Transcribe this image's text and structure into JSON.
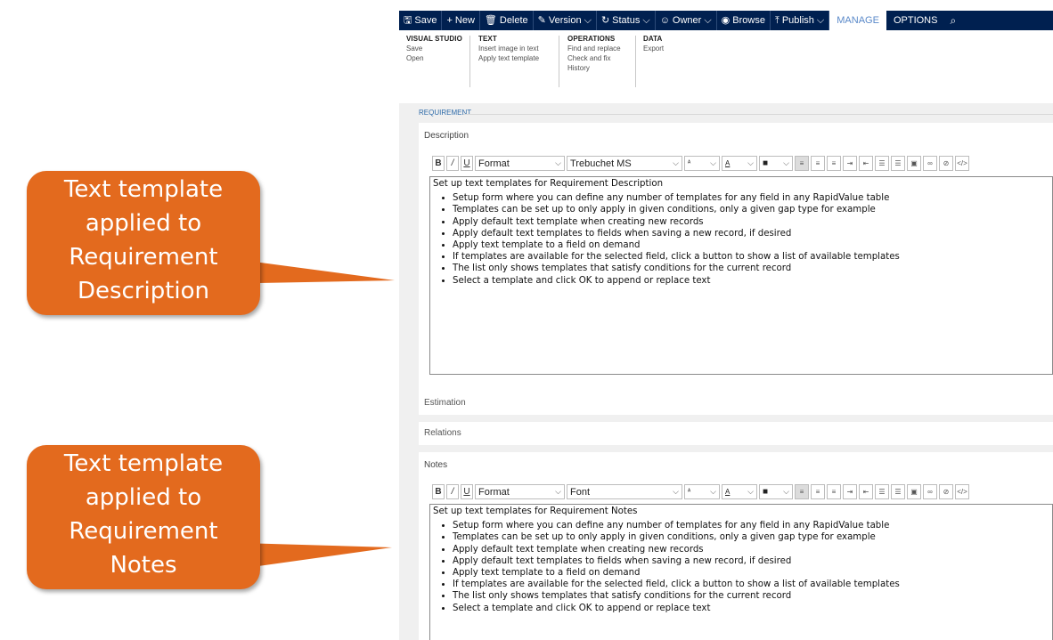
{
  "callouts": [
    {
      "lines": [
        "Text template",
        "applied to",
        "Requirement",
        "Description"
      ]
    },
    {
      "lines": [
        "Text template",
        "applied to",
        "Requirement",
        "Notes"
      ]
    }
  ],
  "colors": {
    "callout": "#e36a1e",
    "navbar": "#002050",
    "accent": "#5a89c9"
  },
  "navbar": {
    "items": [
      {
        "icon": "save-icon",
        "label": "Save"
      },
      {
        "icon": "plus-icon",
        "label": "New"
      },
      {
        "icon": "trash-icon",
        "label": "Delete"
      },
      {
        "icon": "edit-icon",
        "label": "Version"
      },
      {
        "icon": "status-icon",
        "label": "Status"
      },
      {
        "icon": "person-icon",
        "label": "Owner"
      },
      {
        "icon": "eye-icon",
        "label": "Browse"
      },
      {
        "icon": "publish-icon",
        "label": "Publish"
      }
    ],
    "tabs": [
      "MANAGE",
      "OPTIONS"
    ]
  },
  "ribbon": {
    "groups": [
      {
        "header": "VISUAL STUDIO",
        "items": [
          "Save",
          "Open"
        ]
      },
      {
        "header": "TEXT",
        "items": [
          "Insert image in text",
          "Apply text template"
        ]
      },
      {
        "header": "OPERATIONS",
        "items": [
          "Find and replace",
          "Check and fix",
          "History"
        ]
      },
      {
        "header": "DATA",
        "items": [
          "Export"
        ]
      }
    ]
  },
  "section": {
    "label": "REQUIREMENT"
  },
  "description": {
    "title": "Description",
    "toolbar": {
      "format": "Format",
      "font": "Trebuchet MS"
    },
    "heading": "Set up text templates for Requirement Description",
    "bullets": [
      "Setup form where you can define any number of templates for any field in any RapidValue table",
      "Templates can be set up to only apply in given conditions, only a given gap type for example",
      "Apply default text template when creating new records",
      "Apply default text templates to fields when saving a new record, if desired",
      "Apply text template to a field on demand",
      "If templates are available for the selected field, click a button to show a list of available templates",
      "The list only shows templates that satisfy conditions for the current record",
      "Select a template and click OK to append or replace text"
    ]
  },
  "estimation": {
    "title": "Estimation"
  },
  "relations": {
    "title": "Relations"
  },
  "notes": {
    "title": "Notes",
    "toolbar": {
      "format": "Format",
      "font": "Font"
    },
    "heading": "Set up text templates for Requirement Notes",
    "bullets": [
      "Setup form where you can define any number of templates for any field in any RapidValue table",
      "Templates can be set up to only apply in given conditions, only a given gap type for example",
      "Apply default text template when creating new records",
      "Apply default text templates to fields when saving a new record, if desired",
      "Apply text template to a field on demand",
      "If templates are available for the selected field, click a button to show a list of available templates",
      "The list only shows templates that satisfy conditions for the current record",
      "Select a template and click OK to append or replace text"
    ]
  }
}
